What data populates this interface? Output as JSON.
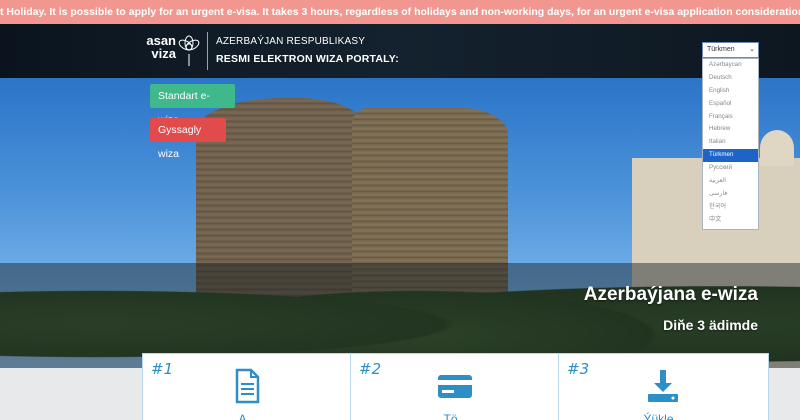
{
  "ticker": {
    "text": "t Holiday. It is possible to apply for an urgent e-visa. It takes 3 hours, regardless of holidays and non-working days, for an urgent e-visa application consideration."
  },
  "header": {
    "logo_line1": "asan",
    "logo_line2": "viza",
    "title_line1": "AZERBAÝJAN RESPUBLIKASY",
    "title_line2": "RESMI ELEKTRON WIZA PORTALY:"
  },
  "language": {
    "selected": "Türkmen",
    "options": [
      "Azərbaycan",
      "Deutsch",
      "English",
      "Español",
      "Français",
      "Hebrew",
      "Italian",
      "Türkmen",
      "Русский",
      "العربية",
      "فارسی",
      "한국어",
      "中文"
    ],
    "selected_index": 7
  },
  "buttons": {
    "standard": "Standart e-wiza",
    "urgent": "Gyssagly wiza"
  },
  "hero": {
    "title": "Azerbaýjana e-wiza",
    "subtitle": "Diňe 3 ädimde"
  },
  "steps": [
    {
      "number": "#1",
      "icon": "document-icon",
      "label": "A..."
    },
    {
      "number": "#2",
      "icon": "credit-card-icon",
      "label": "Tö..."
    },
    {
      "number": "#3",
      "icon": "download-icon",
      "label": "Ýükle..."
    }
  ],
  "colors": {
    "ticker_bg": "#f2978f",
    "header_bg": "#0e1822",
    "green": "#3fb88c",
    "red": "#e14b4b",
    "accent_blue": "#2e8fc6",
    "selected_blue": "#1e64c8"
  }
}
